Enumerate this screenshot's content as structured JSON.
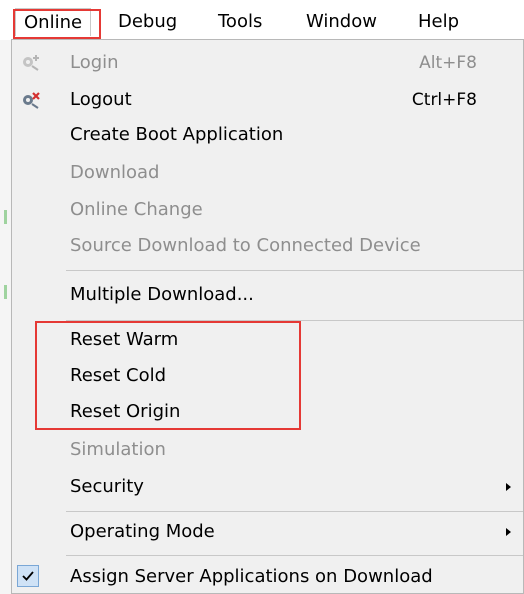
{
  "menubar": {
    "items": [
      {
        "label": "Online"
      },
      {
        "label": "Debug"
      },
      {
        "label": "Tools"
      },
      {
        "label": "Window"
      },
      {
        "label": "Help"
      }
    ]
  },
  "menu": {
    "items": [
      {
        "label": "Login",
        "shortcut": "Alt+F8",
        "enabled": false,
        "icon": "login-icon"
      },
      {
        "label": "Logout",
        "shortcut": "Ctrl+F8",
        "enabled": true,
        "icon": "logout-icon"
      },
      {
        "label": "Create Boot Application",
        "enabled": true
      },
      {
        "label": "Download",
        "enabled": false
      },
      {
        "label": "Online Change",
        "enabled": false
      },
      {
        "label": "Source Download to Connected Device",
        "enabled": false
      },
      {
        "label": "Multiple Download...",
        "enabled": true
      },
      {
        "label": "Reset Warm",
        "enabled": true
      },
      {
        "label": "Reset Cold",
        "enabled": true
      },
      {
        "label": "Reset Origin",
        "enabled": true
      },
      {
        "label": "Simulation",
        "enabled": false
      },
      {
        "label": "Security",
        "enabled": true,
        "submenu": true
      },
      {
        "label": "Operating Mode",
        "enabled": true,
        "submenu": true
      },
      {
        "label": "Assign Server Applications on Download",
        "enabled": true,
        "checked": true
      }
    ]
  },
  "colors": {
    "highlight": "#e53935",
    "disabled_text": "#8e8e8e",
    "menu_bg": "#f0f0f0",
    "check_bg": "#cfe2f6"
  }
}
